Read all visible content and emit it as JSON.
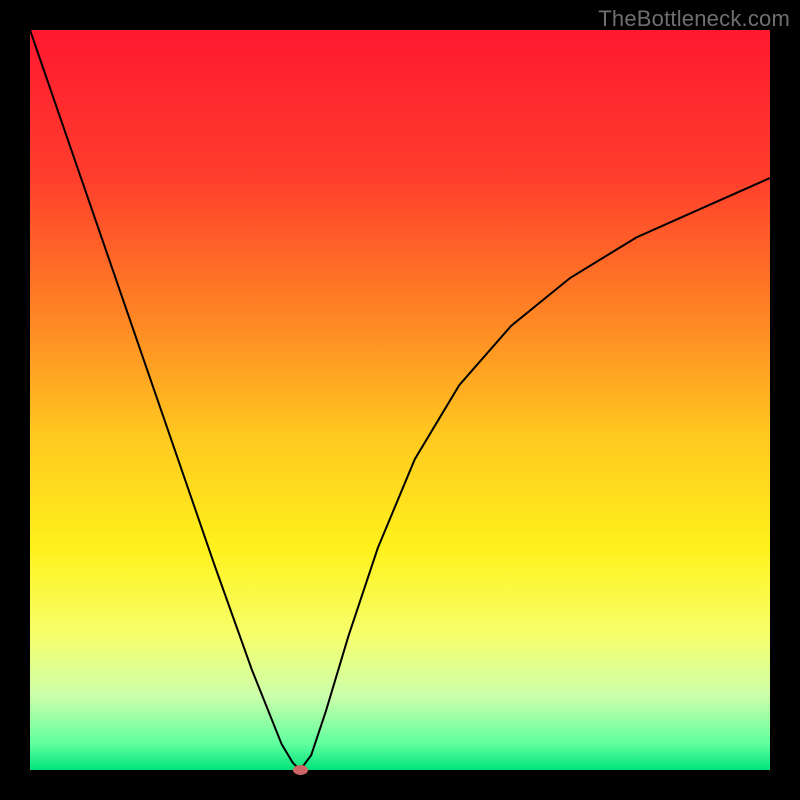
{
  "watermark": "TheBottleneck.com",
  "chart_data": {
    "type": "line",
    "title": "",
    "xlabel": "",
    "ylabel": "",
    "xlim": [
      0,
      1
    ],
    "ylim": [
      0,
      1
    ],
    "background": {
      "type": "vertical_gradient",
      "stops": [
        {
          "pos": 0.0,
          "color": "#ff1830"
        },
        {
          "pos": 0.2,
          "color": "#ff3e2c"
        },
        {
          "pos": 0.4,
          "color": "#ff8a24"
        },
        {
          "pos": 0.55,
          "color": "#ffc91f"
        },
        {
          "pos": 0.7,
          "color": "#fff21c"
        },
        {
          "pos": 0.82,
          "color": "#f6ff6e"
        },
        {
          "pos": 0.9,
          "color": "#ccffab"
        },
        {
          "pos": 0.965,
          "color": "#5fff9e"
        },
        {
          "pos": 1.0,
          "color": "#00e27c"
        }
      ]
    },
    "series": [
      {
        "name": "bottleneck-curve",
        "color": "#000000",
        "x": [
          0.0,
          0.05,
          0.1,
          0.15,
          0.2,
          0.25,
          0.3,
          0.34,
          0.355,
          0.365,
          0.38,
          0.4,
          0.43,
          0.47,
          0.52,
          0.58,
          0.65,
          0.73,
          0.82,
          0.91,
          1.0
        ],
        "y": [
          1.0,
          0.855,
          0.71,
          0.565,
          0.42,
          0.275,
          0.135,
          0.035,
          0.01,
          0.0,
          0.02,
          0.08,
          0.18,
          0.3,
          0.42,
          0.52,
          0.6,
          0.665,
          0.72,
          0.76,
          0.8
        ]
      }
    ],
    "marker": {
      "name": "optimal-point",
      "x": 0.365,
      "y": 0.0,
      "color": "#cc6666"
    },
    "grid": false,
    "legend": null
  }
}
